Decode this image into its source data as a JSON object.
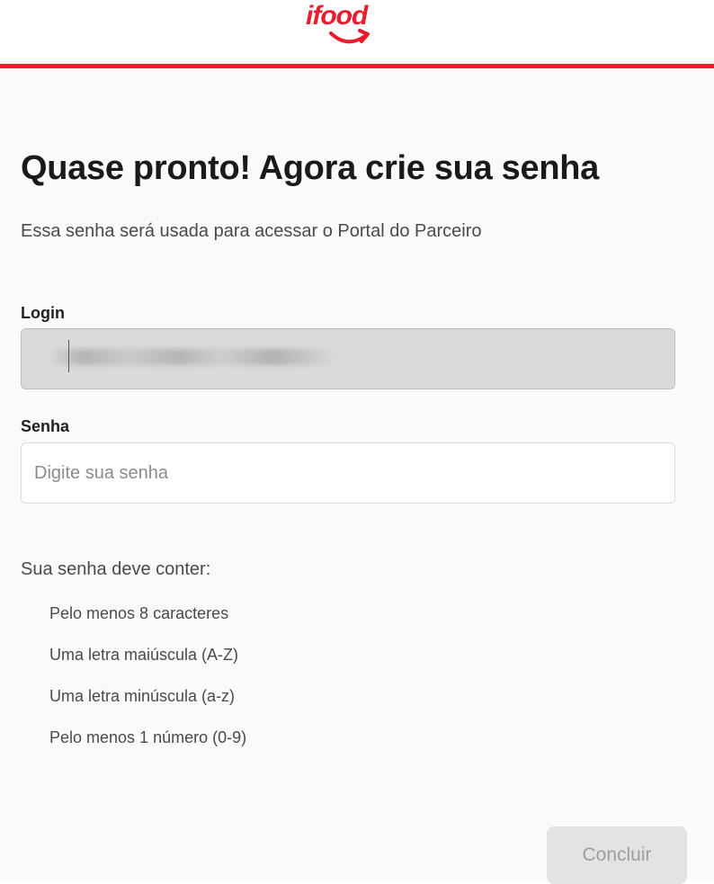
{
  "brand": {
    "logo_text": "ifood",
    "accent_color": "#ea1d2c"
  },
  "page": {
    "title": "Quase pronto! Agora crie sua senha",
    "subtitle": "Essa senha será usada para acessar o Portal do Parceiro"
  },
  "form": {
    "login_label": "Login",
    "login_value": "",
    "senha_label": "Senha",
    "senha_placeholder": "Digite sua senha",
    "senha_value": ""
  },
  "requirements": {
    "title": "Sua senha deve conter:",
    "items": [
      "Pelo menos 8 caracteres",
      "Uma letra maiúscula (A-Z)",
      "Uma letra minúscula (a-z)",
      "Pelo menos 1 número (0-9)"
    ]
  },
  "actions": {
    "submit_label": "Concluir"
  }
}
